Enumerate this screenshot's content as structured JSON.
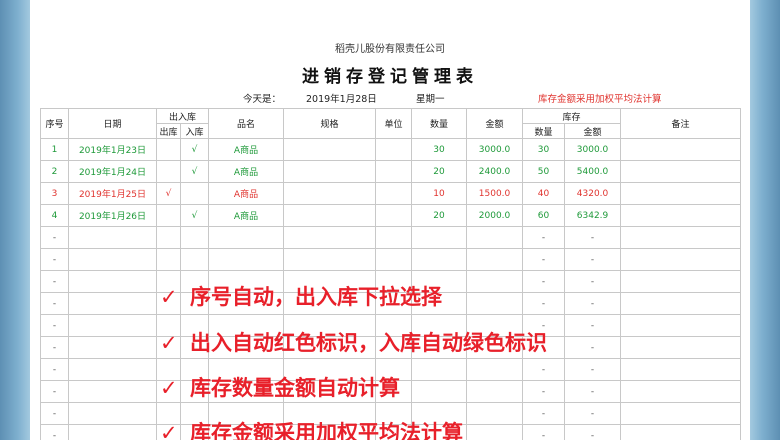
{
  "company": "稻壳儿股份有限责任公司",
  "title": "进销存登记管理表",
  "today_label": "今天是：",
  "date": "2019年1月28日",
  "weekday": "星期一",
  "note": "库存金额采用加权平均法计算",
  "headers": {
    "seq": "序号",
    "date": "日期",
    "inout": "出入库",
    "out": "出库",
    "in": "入库",
    "product": "品名",
    "spec": "规格",
    "unit": "单位",
    "qty": "数量",
    "amount": "金额",
    "stock": "库存",
    "stock_qty": "数量",
    "stock_amount": "金额",
    "remark": "备注"
  },
  "rows": [
    {
      "seq": "1",
      "date": "2019年1月23日",
      "out": "",
      "in": "√",
      "product": "A商品",
      "qty": "30",
      "amount": "3000.0",
      "stock_qty": "30",
      "stock_amount": "3000.0",
      "type": "in"
    },
    {
      "seq": "2",
      "date": "2019年1月24日",
      "out": "",
      "in": "√",
      "product": "A商品",
      "qty": "20",
      "amount": "2400.0",
      "stock_qty": "50",
      "stock_amount": "5400.0",
      "type": "in"
    },
    {
      "seq": "3",
      "date": "2019年1月25日",
      "out": "√",
      "in": "",
      "product": "A商品",
      "qty": "10",
      "amount": "1500.0",
      "stock_qty": "40",
      "stock_amount": "4320.0",
      "type": "out"
    },
    {
      "seq": "4",
      "date": "2019年1月26日",
      "out": "",
      "in": "√",
      "product": "A商品",
      "qty": "20",
      "amount": "2000.0",
      "stock_qty": "60",
      "stock_amount": "6342.9",
      "type": "in"
    }
  ],
  "empty_placeholder": "-",
  "empty_row_count": 10,
  "check_mark": "✓",
  "overlay": [
    "序号自动，出入库下拉选择",
    "出入自动红色标识，入库自动绿色标识",
    "库存数量金额自动计算",
    "库存金额采用加权平均法计算"
  ],
  "colors": {
    "in_row": "#1f9a3a",
    "out_row": "#e0342f",
    "overlay_text": "#e8202a"
  }
}
